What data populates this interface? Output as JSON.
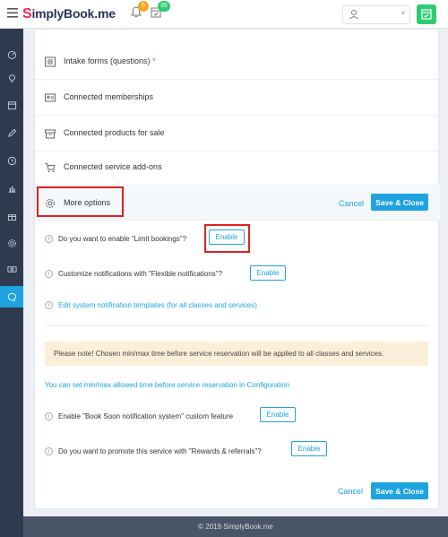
{
  "header": {
    "logo_text": "SimplyBook.me",
    "logo_s": "S",
    "logo_rest": "implyBook.me",
    "notifications_badge": "5",
    "tasks_badge": "35",
    "user_caret": "˅",
    "hamburger_icon": "menu-icon"
  },
  "sidebar": {
    "items": [
      {
        "icon": "dashboard-icon"
      },
      {
        "icon": "lightbulb-icon"
      },
      {
        "icon": "calendar-icon"
      },
      {
        "icon": "pencil-icon"
      },
      {
        "icon": "clock-icon"
      },
      {
        "icon": "bar-chart-icon"
      },
      {
        "icon": "gift-icon"
      },
      {
        "icon": "gear-icon"
      },
      {
        "icon": "money-icon"
      },
      {
        "icon": "chat-icon",
        "active": true
      }
    ]
  },
  "sections": {
    "intake_forms": "Intake forms (questions)",
    "intake_required": "*",
    "memberships": "Connected memberships",
    "products": "Connected products for sale",
    "addons": "Connected service add-ons",
    "more_options": "More options"
  },
  "actions": {
    "cancel": "Cancel",
    "save_close": "Save & Close"
  },
  "options": {
    "limit_bookings": "Do you want to enable \"Limit bookings\"?",
    "flexible_notifications": "Customize notifications with \"Flexible notifications\"?",
    "edit_templates_link": "Edit system notification templates (for all classes and services)",
    "book_soon": "Enable \"Book Soon notification system\" custom feature",
    "rewards": "Do you want to promote this service with \"Rewards & referrals\"?",
    "enable_label": "Enable"
  },
  "notice": {
    "text": "Please note! Chosen min/max time before service reservation will be applied to all classes and services.",
    "config_link": "You can set min/max allowed time before service reservation in Configuration"
  },
  "footer": {
    "copyright": "© 2019 SimplyBook.me"
  },
  "colors": {
    "accent": "#1ea3e0",
    "sidebar": "#2f3a4f",
    "highlight": "#e02020",
    "notice_bg": "#fcefd9",
    "brand_red": "#e8284f"
  }
}
